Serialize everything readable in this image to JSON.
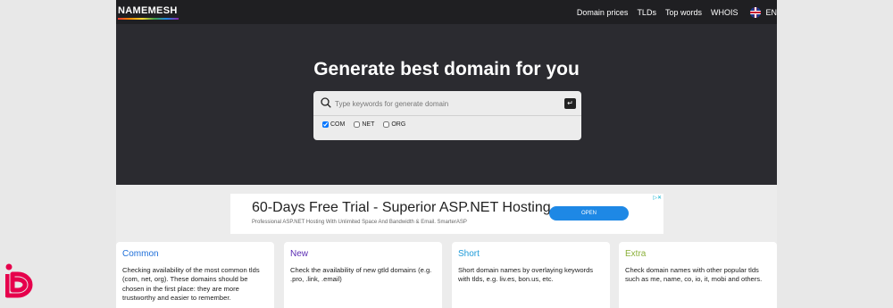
{
  "header": {
    "logo": "NAMEMESH",
    "nav": [
      "Domain prices",
      "TLDs",
      "Top words",
      "WHOIS"
    ],
    "language": "EN"
  },
  "hero": {
    "title": "Generate best domain for you"
  },
  "search": {
    "placeholder": "Type keywords for generate domain",
    "enter_symbol": "↵",
    "tlds": [
      {
        "label": "COM",
        "checked": true
      },
      {
        "label": "NET",
        "checked": false
      },
      {
        "label": "ORG",
        "checked": false
      }
    ]
  },
  "ad": {
    "title": "60-Days Free Trial - Superior ASP.NET Hosting",
    "subtitle": "Professional ASP.NET Hosting With Unlimited Space And Bandwidth & Email. SmarterASP",
    "button": "OPEN"
  },
  "cards": [
    {
      "title": "Common",
      "color": "#1e6fd9",
      "text": "Checking availability of the most common tlds (com, net, org). These domains should be chosen in the first place: they are more trustworthy and easier to remember."
    },
    {
      "title": "New",
      "color": "#5b2db3",
      "text": "Check the availability of new gtld domains (e.g. .pro, .link, .email)"
    },
    {
      "title": "Short",
      "color": "#1e9bd9",
      "text": "Short domain names by overlaying keywords with tlds, e.g. liv.es, bon.us, etc."
    },
    {
      "title": "Extra",
      "color": "#8bb03a",
      "text": "Check domain names with other popular tlds such as me, name, co, io, it, mobi and others."
    }
  ],
  "colors": {
    "page_background": "#2b2b30",
    "topbar": "#1f1f22",
    "accent_blue": "#1e88e5",
    "brand_logo": "#e6004c"
  }
}
